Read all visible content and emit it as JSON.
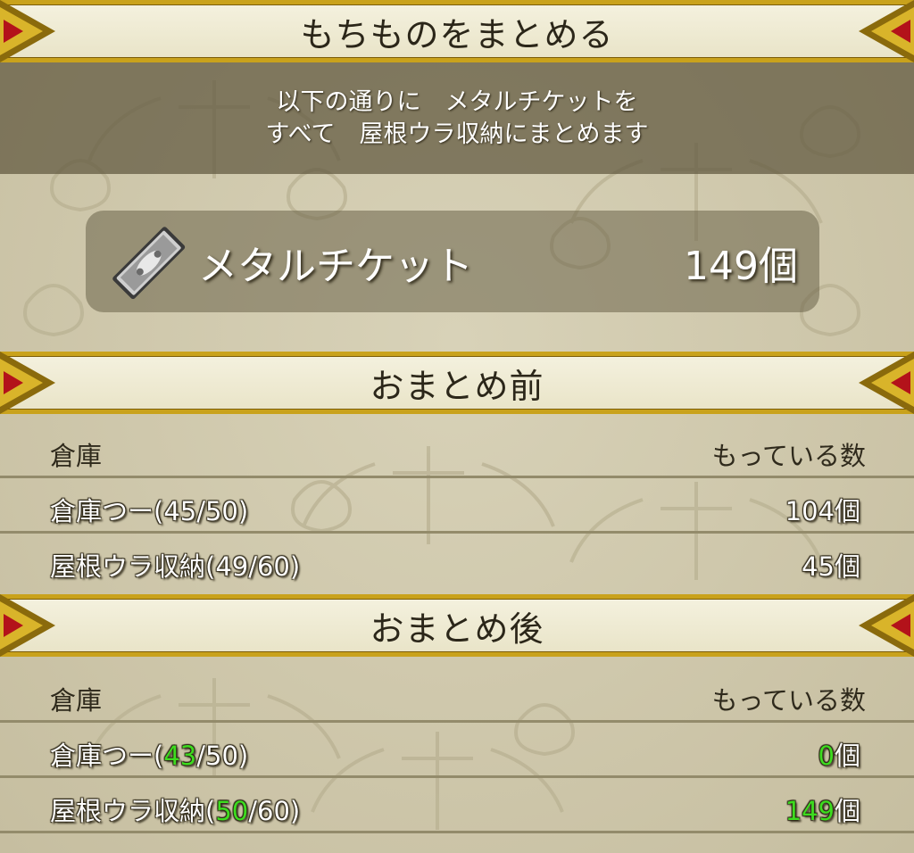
{
  "title": "もちものをまとめる",
  "message": {
    "line1": "以下の通りに　メタルチケットを",
    "line2": "すべて　屋根ウラ収納にまとめます"
  },
  "item": {
    "icon": "metal-ticket-icon",
    "name": "メタルチケット",
    "count": "149個"
  },
  "before": {
    "title": "おまとめ前",
    "col_location": "倉庫",
    "col_count": "もっている数",
    "rows": [
      {
        "label": "倉庫つー(45/50)",
        "count": "104個"
      },
      {
        "label": "屋根ウラ収納(49/60)",
        "count": "45個"
      }
    ]
  },
  "after": {
    "title": "おまとめ後",
    "col_location": "倉庫",
    "col_count": "もっている数",
    "rows": [
      {
        "name": "倉庫つー(",
        "used": "43",
        "cap": "/50)",
        "count_value": "0",
        "count_unit": "個"
      },
      {
        "name": "屋根ウラ収納(",
        "used": "50",
        "cap": "/60)",
        "count_value": "149",
        "count_unit": "個"
      }
    ]
  },
  "colors": {
    "gold": "#c9a21c",
    "highlight_green": "#3ddc1f",
    "corner_red": "#b3121a"
  }
}
